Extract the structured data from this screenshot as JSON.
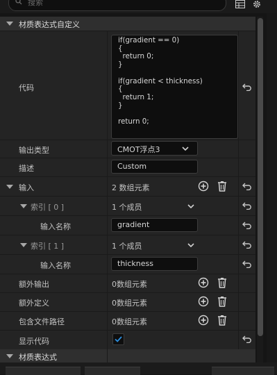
{
  "search": {
    "placeholder": "搜索"
  },
  "toolbar": {
    "grid_icon": "grid-view-icon",
    "settings_icon": "gear-icon"
  },
  "category_custom": {
    "title": "材质表达式自定义"
  },
  "rows": {
    "code": {
      "label": "代码",
      "value": "if(gradient == 0)\n{\n  return 0;\n}\n\nif(gradient < thickness)\n{\n  return 1;\n}\n\nreturn 0;"
    },
    "output_type": {
      "label": "输出类型",
      "value": "CMOT浮点3"
    },
    "description": {
      "label": "描述",
      "value": "Custom"
    },
    "inputs": {
      "label": "输入",
      "value": "2 数组元素"
    },
    "index0": {
      "label": "索引 [ 0 ]",
      "value": "1 个成员"
    },
    "input_name0": {
      "label": "输入名称",
      "value": "gradient"
    },
    "index1": {
      "label": "索引 [ 1 ]",
      "value": "1 个成员"
    },
    "input_name1": {
      "label": "输入名称",
      "value": "thickness"
    },
    "extra_outputs": {
      "label": "额外输出",
      "value": "0数组元素"
    },
    "extra_defines": {
      "label": "额外定义",
      "value": "0数组元素"
    },
    "include_paths": {
      "label": "包含文件路径",
      "value": "0数组元素"
    },
    "show_code": {
      "label": "显示代码",
      "checked": true
    }
  },
  "category_expr": {
    "title": "材质表达式"
  },
  "colors": {
    "accent": "#2b8fe0",
    "panel": "#242424",
    "category": "#2f2f2f"
  }
}
